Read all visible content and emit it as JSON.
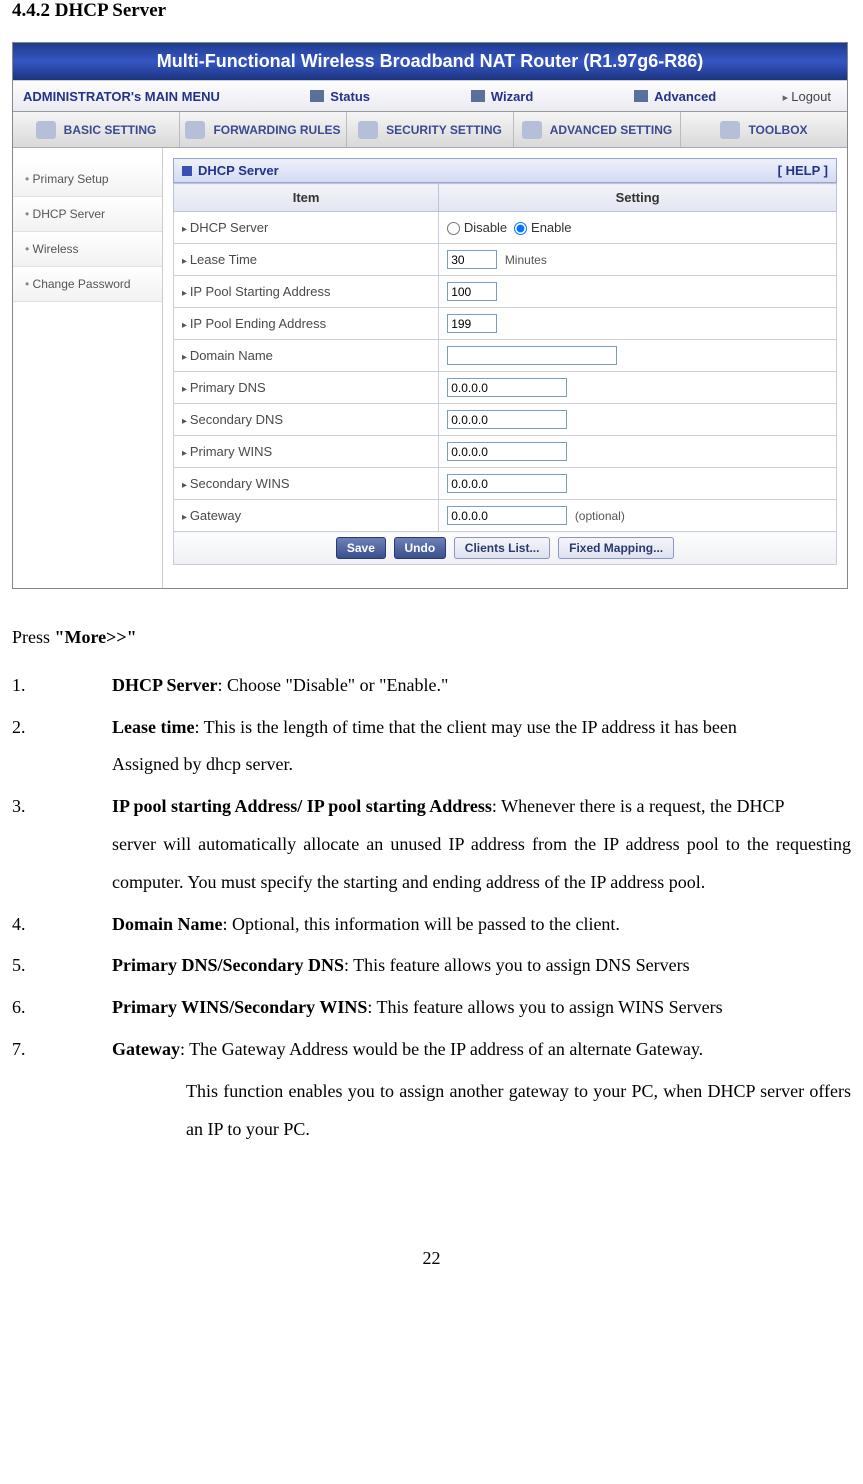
{
  "section_title": "4.4.2 DHCP Server",
  "screenshot": {
    "titlebar": "Multi-Functional Wireless Broadband NAT Router (R1.97g6-R86)",
    "mainmenu_label": "ADMINISTRATOR's MAIN MENU",
    "mainmenu_items": {
      "status": "Status",
      "wizard": "Wizard",
      "advanced": "Advanced"
    },
    "logout": "Logout",
    "tabs": {
      "basic": "BASIC SETTING",
      "forwarding": "FORWARDING RULES",
      "security": "SECURITY SETTING",
      "advanced": "ADVANCED SETTING",
      "toolbox": "TOOLBOX"
    },
    "sidebar": {
      "primary_setup": "Primary Setup",
      "dhcp_server": "DHCP Server",
      "wireless": "Wireless",
      "change_password": "Change Password"
    },
    "panel": {
      "title": "DHCP Server",
      "help": "[ HELP ]",
      "col_item": "Item",
      "col_setting": "Setting",
      "rows": {
        "dhcp_server_label": "DHCP Server",
        "dhcp_disable": "Disable",
        "dhcp_enable": "Enable",
        "lease_time_label": "Lease Time",
        "lease_time_value": "30",
        "lease_time_unit": "Minutes",
        "ip_start_label": "IP Pool Starting Address",
        "ip_start_value": "100",
        "ip_end_label": "IP Pool Ending Address",
        "ip_end_value": "199",
        "domain_label": "Domain Name",
        "domain_value": "",
        "primary_dns_label": "Primary DNS",
        "primary_dns_value": "0.0.0.0",
        "secondary_dns_label": "Secondary DNS",
        "secondary_dns_value": "0.0.0.0",
        "primary_wins_label": "Primary WINS",
        "primary_wins_value": "0.0.0.0",
        "secondary_wins_label": "Secondary WINS",
        "secondary_wins_value": "0.0.0.0",
        "gateway_label": "Gateway",
        "gateway_value": "0.0.0.0",
        "gateway_optional": "(optional)"
      },
      "buttons": {
        "save": "Save",
        "undo": "Undo",
        "clients": "Clients List...",
        "fixed": "Fixed Mapping..."
      }
    }
  },
  "doc": {
    "press_more_pre": "Press ",
    "press_more_bold": "\"More>>\"",
    "items": {
      "n1": "1.",
      "t1_bold": "DHCP Server",
      "t1_rest": ": Choose \"Disable\" or \"Enable.\"",
      "n2": "2.",
      "t2_bold": "Lease time",
      "t2_rest": ": This is the length of time that the client may use the IP address it has been",
      "t2_sub": "Assigned by dhcp server.",
      "n3": "3.",
      "t3_bold": "IP pool starting Address/ IP pool starting Address",
      "t3_rest": ": Whenever there is a request, the DHCP",
      "t3_sub": "server will automatically allocate an unused IP address from the IP address pool to the requesting computer. You must specify the starting and ending address of the IP address pool.",
      "n4": "4.",
      "t4_bold": "Domain Name",
      "t4_rest": ": Optional, this information will be passed to the client.",
      "n5": "5.",
      "t5_bold": "Primary DNS/Secondary DNS",
      "t5_rest": ": This feature allows you to assign DNS Servers",
      "n6": "6.",
      "t6_bold": "Primary WINS/Secondary WINS",
      "t6_rest": ": This feature allows you to assign WINS Servers",
      "n7": "7.",
      "t7_bold": "Gateway",
      "t7_rest": ": The Gateway Address would be the IP address of an alternate Gateway.",
      "t7_sub": "This function enables you to assign another gateway to your PC, when DHCP server offers an IP to your PC."
    }
  },
  "page_number": "22"
}
